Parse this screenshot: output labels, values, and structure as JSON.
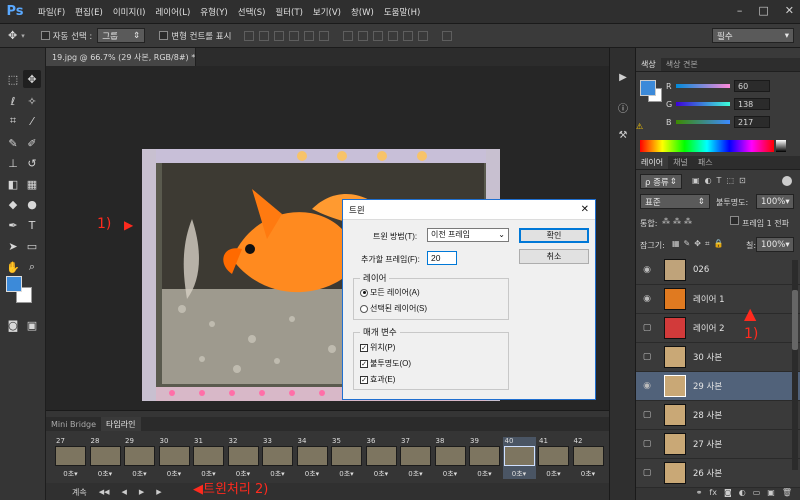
{
  "menubar": {
    "logo": "Ps",
    "items": [
      "파일(F)",
      "편집(E)",
      "이미지(I)",
      "레이어(L)",
      "유형(Y)",
      "선택(S)",
      "필터(T)",
      "보기(V)",
      "창(W)",
      "도움말(H)"
    ],
    "win_controls": [
      "–",
      "□",
      "✕"
    ]
  },
  "optbar": {
    "auto_select_label": "자동 선택 :",
    "auto_select_value": "그룹",
    "transform_controls_label": "변형 컨트롤 표시",
    "workspace": "필수"
  },
  "document": {
    "tab_title": "19.jpg @ 66.7% (29 사본, RGB/8#) *",
    "tab_close": "×"
  },
  "color_panel": {
    "tabs": [
      "색상",
      "색상 견본"
    ],
    "channels": [
      {
        "label": "R",
        "value": "60"
      },
      {
        "label": "G",
        "value": "138"
      },
      {
        "label": "B",
        "value": "217"
      }
    ],
    "color": "#3c8ad9"
  },
  "layers_panel": {
    "tabs": [
      "레이어",
      "채널",
      "패스"
    ],
    "kind_filter": "ρ 종류",
    "blend_mode": "표준",
    "opacity_label": "불투명도:",
    "opacity_value": "100%",
    "unify_label": "통합:",
    "propagate_label": "프레임 1 전파",
    "lock_label": "잠그기:",
    "fill_label": "칠:",
    "fill_value": "100%",
    "layers": [
      {
        "name": "026",
        "visible": true,
        "selected": false
      },
      {
        "name": "레이어 1",
        "visible": true,
        "selected": false
      },
      {
        "name": "레이어 2",
        "visible": false,
        "selected": false
      },
      {
        "name": "30 사본",
        "visible": false,
        "selected": false
      },
      {
        "name": "29 사본",
        "visible": true,
        "selected": true
      },
      {
        "name": "28 사본",
        "visible": false,
        "selected": false
      },
      {
        "name": "27 사본",
        "visible": false,
        "selected": false
      },
      {
        "name": "26 사본",
        "visible": false,
        "selected": false
      }
    ]
  },
  "timeline": {
    "tabs": [
      "Mini Bridge",
      "타임라인"
    ],
    "frames": [
      {
        "num": "27",
        "delay": "0초▾"
      },
      {
        "num": "28",
        "delay": "0초▾"
      },
      {
        "num": "29",
        "delay": "0초▾"
      },
      {
        "num": "30",
        "delay": "0초▾"
      },
      {
        "num": "31",
        "delay": "0초▾"
      },
      {
        "num": "32",
        "delay": "0초▾"
      },
      {
        "num": "33",
        "delay": "0초▾"
      },
      {
        "num": "34",
        "delay": "0초▾"
      },
      {
        "num": "35",
        "delay": "0초▾"
      },
      {
        "num": "36",
        "delay": "0초▾"
      },
      {
        "num": "37",
        "delay": "0초▾"
      },
      {
        "num": "38",
        "delay": "0초▾"
      },
      {
        "num": "39",
        "delay": "0초▾"
      },
      {
        "num": "40",
        "delay": "0초▾",
        "selected": true
      },
      {
        "num": "41",
        "delay": "0초▾"
      },
      {
        "num": "42",
        "delay": "0초▾"
      }
    ],
    "loop_label": "계속",
    "controls": [
      "◀◀",
      "◀",
      "▶",
      "▶"
    ]
  },
  "dialog": {
    "title": "트윈",
    "close": "✕",
    "tween_with_label": "트윈 방법(T):",
    "tween_with_value": "이전 프레임",
    "frames_to_add_label": "추가할 프레임(F):",
    "frames_to_add_value": "20",
    "ok_label": "확인",
    "cancel_label": "취소",
    "layers_group": "레이어",
    "all_layers": "모든 레이어(A)",
    "selected_layers": "선택된 레이어(S)",
    "params_group": "매개 변수",
    "position": "위치(P)",
    "opacity": "불투명도(O)",
    "effects": "효과(E)"
  },
  "annotations": {
    "a1": "1)",
    "a1_arrow": "▶",
    "a2": "◀트윈처리 2)",
    "a3": "1)",
    "a3_arrow": "▲"
  }
}
